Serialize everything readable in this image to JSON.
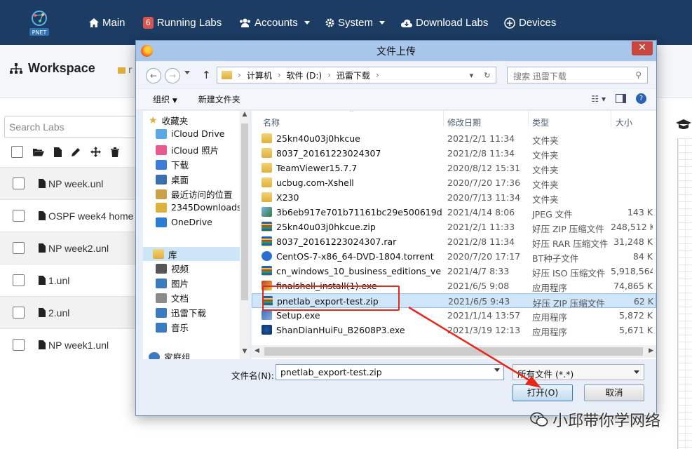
{
  "app": {
    "logo_text": "PNET",
    "nav": [
      {
        "label": "Main",
        "icon": "home-icon",
        "badge": ""
      },
      {
        "label": "Running Labs",
        "icon": "badge",
        "badge": "6"
      },
      {
        "label": "Accounts",
        "icon": "users-icon",
        "badge": ""
      },
      {
        "label": "System",
        "icon": "gear-icon",
        "badge": ""
      },
      {
        "label": "Download Labs",
        "icon": "cloud-download-icon",
        "badge": ""
      },
      {
        "label": "Devices",
        "icon": "plus-circle-icon",
        "badge": ""
      }
    ],
    "workspace_title": "Workspace",
    "folder_fragment": "r",
    "search_placeholder": "Search Labs",
    "labs": [
      "NP week.unl",
      "OSPF week4 home",
      "NP week2.unl",
      "1.unl",
      "2.unl",
      "NP week1.unl"
    ]
  },
  "dialog": {
    "title": "文件上传",
    "close_label": "✕",
    "path": [
      "计算机",
      "软件 (D:)",
      "迅雷下载"
    ],
    "search_placeholder": "搜索 迅雷下载",
    "organize_label": "组织",
    "new_folder_label": "新建文件夹",
    "nav_tree": {
      "favorites": "收藏夹",
      "favorites_items": [
        "iCloud Drive",
        "iCloud 照片",
        "下载",
        "桌面",
        "最近访问的位置",
        "2345Downloads",
        "OneDrive"
      ],
      "library": "库",
      "library_items": [
        "视频",
        "图片",
        "文档",
        "迅雷下载",
        "音乐"
      ],
      "partial": "家庭组"
    },
    "columns": {
      "name": "名称",
      "date": "修改日期",
      "type": "类型",
      "size": "大小"
    },
    "files": [
      {
        "name": "25kn40u03j0hkcue",
        "date": "2021/2/1 11:34",
        "type": "文件夹",
        "size": "",
        "icon": "folder"
      },
      {
        "name": "8037_20161223024307",
        "date": "2021/2/8 11:34",
        "type": "文件夹",
        "size": "",
        "icon": "folder"
      },
      {
        "name": "TeamViewer15.7.7",
        "date": "2020/8/12 15:31",
        "type": "文件夹",
        "size": "",
        "icon": "folder"
      },
      {
        "name": "ucbug.com-Xshell",
        "date": "2020/7/20 17:36",
        "type": "文件夹",
        "size": "",
        "icon": "folder"
      },
      {
        "name": "X230",
        "date": "2020/7/13 11:34",
        "type": "文件夹",
        "size": "",
        "icon": "folder"
      },
      {
        "name": "3b6eb917e701b71161bc29e500619d...",
        "date": "2021/4/14 8:06",
        "type": "JPEG 文件",
        "size": "143 K",
        "icon": "jpg"
      },
      {
        "name": "25kn40u03j0hkcue.zip",
        "date": "2021/2/1 11:33",
        "type": "好压 ZIP 压缩文件",
        "size": "248,512 K",
        "icon": "zip"
      },
      {
        "name": "8037_20161223024307.rar",
        "date": "2021/2/8 11:34",
        "type": "好压 RAR 压缩文件",
        "size": "31,248 K",
        "icon": "zip"
      },
      {
        "name": "CentOS-7-x86_64-DVD-1804.torrent",
        "date": "2020/7/20 17:17",
        "type": "BT种子文件",
        "size": "84 K",
        "icon": "bt"
      },
      {
        "name": "cn_windows_10_business_editions_ver...",
        "date": "2021/4/7 8:33",
        "type": "好压 ISO 压缩文件",
        "size": "5,918,564",
        "icon": "zip"
      },
      {
        "name": "finalshell_install(1).exe",
        "date": "2021/6/5 9:08",
        "type": "应用程序",
        "size": "74,865 K",
        "icon": "exe"
      },
      {
        "name": "pnetlab_export-test.zip",
        "date": "2021/6/5 9:43",
        "type": "好压 ZIP 压缩文件",
        "size": "62 K",
        "icon": "zip",
        "selected": true
      },
      {
        "name": "Setup.exe",
        "date": "2021/1/14 13:57",
        "type": "应用程序",
        "size": "5,872 K",
        "icon": "exe2"
      },
      {
        "name": "ShanDianHuiFu_B2608P3.exe",
        "date": "2021/3/19 12:13",
        "type": "应用程序",
        "size": "5,671 K",
        "icon": "sd"
      }
    ],
    "filename_label": "文件名(N):",
    "filename_value": "pnetlab_export-test.zip",
    "filetype_value": "所有文件 (*.*)",
    "open_label": "打开(O)",
    "cancel_label": "取消"
  },
  "watermark": "小邱带你学网络",
  "colors": {
    "navbar": "#1c3c64",
    "dialog_title": "#a8c6ea",
    "selection": "#cfe5fa",
    "annotation_red": "#e8271b"
  }
}
